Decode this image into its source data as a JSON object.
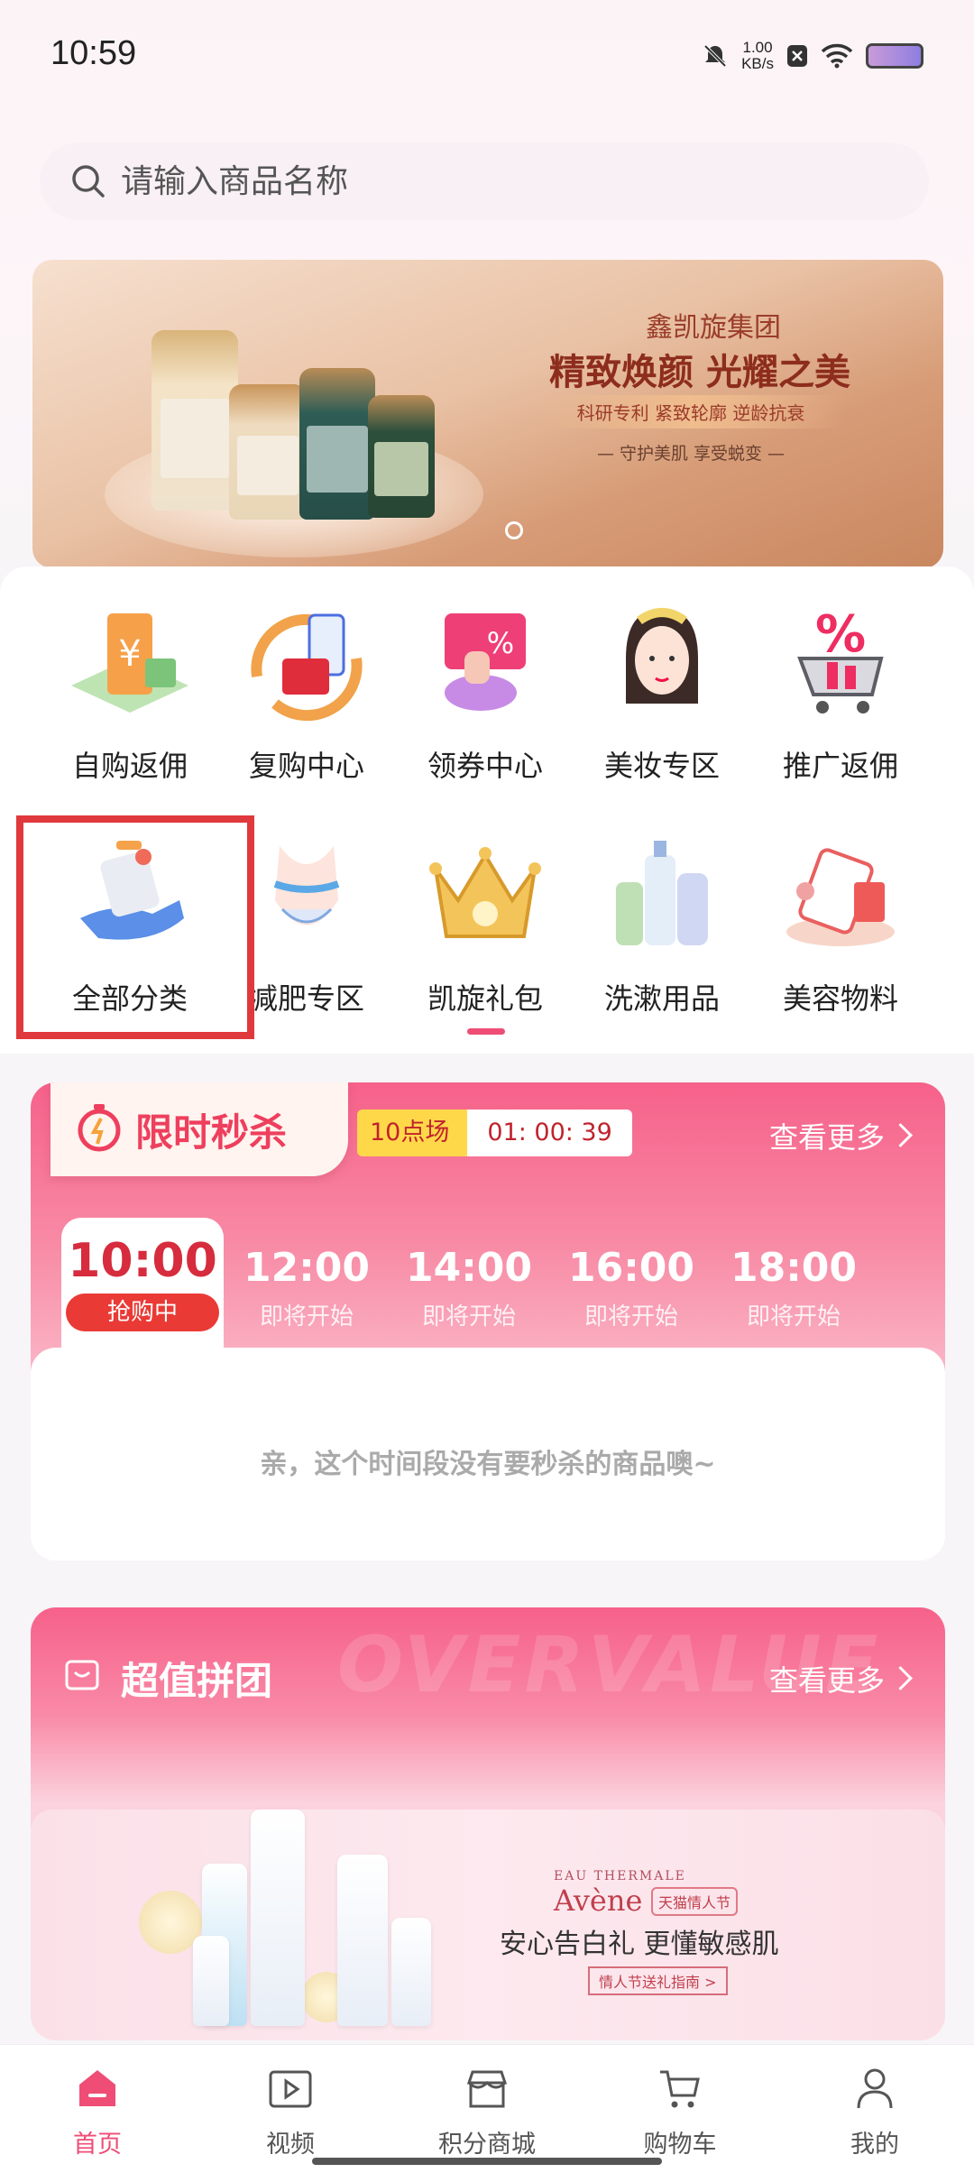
{
  "status_bar": {
    "time": "10:59",
    "net_speed_value": "1.00",
    "net_speed_unit": "KB/s"
  },
  "search": {
    "placeholder": "请输入商品名称"
  },
  "banner": {
    "brand": "鑫凯旋集团",
    "slogan": "精致焕颜 光耀之美",
    "tags": "科研专利 紧致轮廓 逆龄抗衰",
    "subline": "— 守护美肌 享受蜕变 —"
  },
  "categories": [
    {
      "label": "自购返佣",
      "icon": "cashback-icon"
    },
    {
      "label": "复购中心",
      "icon": "repurchase-icon"
    },
    {
      "label": "领券中心",
      "icon": "coupon-icon"
    },
    {
      "label": "美妆专区",
      "icon": "makeup-icon"
    },
    {
      "label": "推广返佣",
      "icon": "promo-cart-icon"
    },
    {
      "label": "全部分类",
      "icon": "all-categories-icon"
    },
    {
      "label": "减肥专区",
      "icon": "slimming-icon"
    },
    {
      "label": "凯旋礼包",
      "icon": "crown-gift-icon"
    },
    {
      "label": "洗漱用品",
      "icon": "toiletries-icon"
    },
    {
      "label": "美容物料",
      "icon": "beauty-supplies-icon"
    }
  ],
  "flash_sale": {
    "title": "限时秒杀",
    "session_name": "10点场",
    "countdown": "01: 00: 39",
    "more": "查看更多",
    "slots": [
      {
        "time": "10:00",
        "status": "抢购中"
      },
      {
        "time": "12:00",
        "status": "即将开始"
      },
      {
        "time": "14:00",
        "status": "即将开始"
      },
      {
        "time": "16:00",
        "status": "即将开始"
      },
      {
        "time": "18:00",
        "status": "即将开始"
      }
    ],
    "empty_message": "亲，这个时间段没有要秒杀的商品噢~"
  },
  "group_buy": {
    "title": "超值拼团",
    "more": "查看更多",
    "watermark": "OVERVALUE",
    "ad": {
      "brand_small": "EAU THERMALE",
      "brand": "Avène",
      "event": "天猫情人节",
      "slogan": "安心告白礼 更懂敏感肌",
      "button": "情人节送礼指南 >"
    }
  },
  "tabbar": [
    {
      "label": "首页",
      "icon": "home-icon",
      "active": true
    },
    {
      "label": "视频",
      "icon": "video-icon"
    },
    {
      "label": "积分商城",
      "icon": "points-store-icon"
    },
    {
      "label": "购物车",
      "icon": "cart-icon"
    },
    {
      "label": "我的",
      "icon": "profile-icon"
    }
  ],
  "colors": {
    "accent": "#ef4d75",
    "flash_red": "#ee3f5e",
    "highlight": "#e0393d"
  }
}
